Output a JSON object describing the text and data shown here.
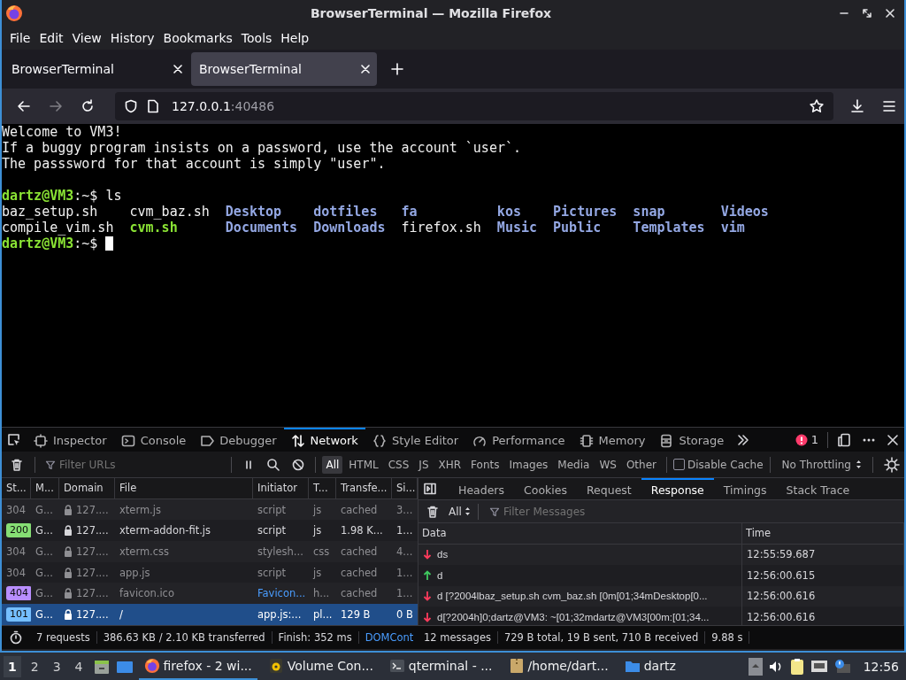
{
  "window": {
    "title": "BrowserTerminal — Mozilla Firefox"
  },
  "menu": [
    "File",
    "Edit",
    "View",
    "History",
    "Bookmarks",
    "Tools",
    "Help"
  ],
  "tabs": [
    {
      "label": "BrowserTerminal",
      "selected": false
    },
    {
      "label": "BrowserTerminal",
      "selected": true
    }
  ],
  "address": {
    "host": "127.0.0.1",
    "port": ":40486"
  },
  "terminal": {
    "lines": [
      {
        "kind": "text",
        "text": "Welcome to VM3!"
      },
      {
        "kind": "text",
        "text": "If a buggy program insists on a password, use the account `user`."
      },
      {
        "kind": "text",
        "text": "The passsword for that account is simply \"user\"."
      },
      {
        "kind": "blank"
      },
      {
        "kind": "prompt",
        "user": "dartz@VM3",
        "path": ":~$",
        "command": "ls",
        "cursor": false
      },
      {
        "kind": "listing",
        "columns": [
          [
            {
              "name": "baz_setup.sh",
              "kind": "file"
            },
            {
              "name": "compile_vim.sh",
              "kind": "file"
            }
          ],
          [
            {
              "name": "cvm_baz.sh",
              "kind": "file"
            },
            {
              "name": "cvm.sh",
              "kind": "exec"
            }
          ],
          [
            {
              "name": "Desktop",
              "kind": "dir"
            },
            {
              "name": "Documents",
              "kind": "dir"
            }
          ],
          [
            {
              "name": "dotfiles",
              "kind": "dir"
            },
            {
              "name": "Downloads",
              "kind": "dir"
            }
          ],
          [
            {
              "name": "fa",
              "kind": "dir"
            },
            {
              "name": "firefox.sh",
              "kind": "file"
            }
          ],
          [
            {
              "name": "kos",
              "kind": "dir"
            },
            {
              "name": "Music",
              "kind": "dir"
            }
          ],
          [
            {
              "name": "Pictures",
              "kind": "dir"
            },
            {
              "name": "Public",
              "kind": "dir"
            }
          ],
          [
            {
              "name": "snap",
              "kind": "dir"
            },
            {
              "name": "Templates",
              "kind": "dir"
            }
          ],
          [
            {
              "name": "Videos",
              "kind": "dir"
            },
            {
              "name": "vim",
              "kind": "dir"
            }
          ]
        ]
      },
      {
        "kind": "prompt",
        "user": "dartz@VM3",
        "path": ":~$",
        "cursor": true
      }
    ]
  },
  "devtools": {
    "tabs": [
      {
        "label": "Inspector",
        "kind": "inspector",
        "selected": false
      },
      {
        "label": "Console",
        "kind": "console",
        "selected": false
      },
      {
        "label": "Debugger",
        "kind": "debugger",
        "selected": false
      },
      {
        "label": "Network",
        "kind": "network",
        "selected": true
      },
      {
        "label": "Style Editor",
        "kind": "style",
        "selected": false
      },
      {
        "label": "Performance",
        "kind": "performance",
        "selected": false
      },
      {
        "label": "Memory",
        "kind": "memory",
        "selected": false
      },
      {
        "label": "Storage",
        "kind": "storage",
        "selected": false
      }
    ],
    "error_count": "1",
    "filter_placeholder": "Filter URLs",
    "type_filters": [
      {
        "label": "All",
        "selected": true
      },
      {
        "label": "HTML",
        "selected": false
      },
      {
        "label": "CSS",
        "selected": false
      },
      {
        "label": "JS",
        "selected": false
      },
      {
        "label": "XHR",
        "selected": false
      },
      {
        "label": "Fonts",
        "selected": false
      },
      {
        "label": "Images",
        "selected": false
      },
      {
        "label": "Media",
        "selected": false
      },
      {
        "label": "WS",
        "selected": false
      },
      {
        "label": "Other",
        "selected": false
      }
    ],
    "disable_cache": {
      "label": "Disable Cache",
      "checked": false
    },
    "throttling": "No Throttling",
    "requests": {
      "columns": [
        "St...",
        "M...",
        "Domain",
        "File",
        "Initiator",
        "T...",
        "Transfe...",
        "Si..."
      ],
      "rows": [
        {
          "status": "304",
          "method": "G...",
          "domain": "127....",
          "file": "xterm.js",
          "initiator": "script",
          "initiator_link": false,
          "type": "js",
          "transferred": "cached",
          "size": "3...",
          "dimmed": true,
          "selected": false
        },
        {
          "status": "200",
          "color": "#86de74",
          "method": "G...",
          "domain": "127....",
          "file": "xterm-addon-fit.js",
          "initiator": "script",
          "initiator_link": false,
          "type": "js",
          "transferred": "1.98 K...",
          "size": "1...",
          "dimmed": false,
          "selected": false
        },
        {
          "status": "304",
          "method": "G...",
          "domain": "127....",
          "file": "xterm.css",
          "initiator": "stylesh...",
          "initiator_link": false,
          "type": "css",
          "transferred": "cached",
          "size": "4...",
          "dimmed": true,
          "selected": false
        },
        {
          "status": "304",
          "method": "G...",
          "domain": "127....",
          "file": "app.js",
          "initiator": "script",
          "initiator_link": false,
          "type": "js",
          "transferred": "cached",
          "size": "1...",
          "dimmed": true,
          "selected": false
        },
        {
          "status": "404",
          "color": "#b98eff",
          "method": "G...",
          "domain": "127....",
          "file": "favicon.ico",
          "initiator": "Favicon...",
          "initiator_link": true,
          "type": "h...",
          "transferred": "cached",
          "size": "1...",
          "dimmed": true,
          "selected": false
        },
        {
          "status": "101",
          "color": "#75bfff",
          "method": "G...",
          "domain": "127....",
          "file": "/",
          "initiator": "app.js:...",
          "initiator_link": false,
          "type": "pl...",
          "transferred": "129 B",
          "size": "0 B",
          "dimmed": false,
          "selected": true
        }
      ]
    },
    "detail_tabs": [
      {
        "label": "Headers",
        "selected": false
      },
      {
        "label": "Cookies",
        "selected": false
      },
      {
        "label": "Request",
        "selected": false
      },
      {
        "label": "Response",
        "selected": true
      },
      {
        "label": "Timings",
        "selected": false
      },
      {
        "label": "Stack Trace",
        "selected": false
      }
    ],
    "message_filter": "All",
    "message_placeholder": "Filter Messages",
    "message_columns": [
      "Data",
      "Time"
    ],
    "messages": [
      {
        "kind": "received",
        "data": "ds",
        "time": "12:55:59.687"
      },
      {
        "kind": "sent",
        "data": "d",
        "time": "12:56:00.615"
      },
      {
        "kind": "received",
        "data": "d [?2004lbaz_setup.sh cvm_baz.sh [0m[01;34mDesktop[0...",
        "time": "12:56:00.616"
      },
      {
        "kind": "received",
        "data": "d[?2004h]0;dartz@VM3: ~[01;32mdartz@VM3[00m:[01;34...",
        "time": "12:56:00.616"
      }
    ],
    "status_left": [
      {
        "kind": "plain",
        "text": "7 requests"
      },
      {
        "kind": "plain",
        "text": "386.63 KB / 2.10 KB transferred"
      },
      {
        "kind": "plain",
        "text": "Finish: 352 ms"
      },
      {
        "kind": "link",
        "text": "DOMCont"
      }
    ],
    "status_right": [
      "12 messages",
      "729 B total, 19 B sent, 710 B received",
      "9.88 s"
    ]
  },
  "taskbar": {
    "workspaces": [
      {
        "label": "1",
        "selected": true
      },
      {
        "label": "2",
        "selected": false
      },
      {
        "label": "3",
        "selected": false
      },
      {
        "label": "4",
        "selected": false
      }
    ],
    "tasks": [
      {
        "label": "firefox - 2 wi...",
        "kind": "firefox",
        "selected": true
      },
      {
        "label": "Volume Con...",
        "kind": "volume",
        "selected": false
      },
      {
        "label": "qterminal - ...",
        "kind": "terminal",
        "selected": false
      },
      {
        "label": "/home/dart...",
        "kind": "archive",
        "selected": false
      },
      {
        "label": "dartz",
        "kind": "folder",
        "selected": false
      }
    ],
    "clock": "12:56"
  }
}
